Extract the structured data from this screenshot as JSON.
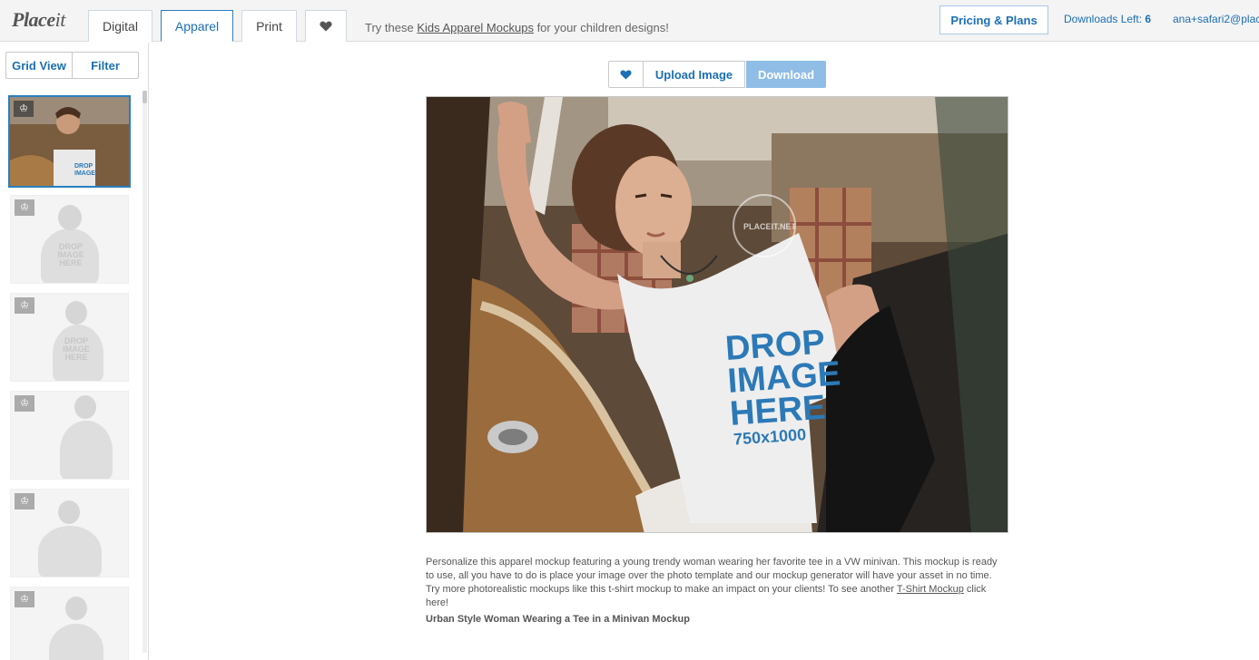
{
  "header": {
    "logo_main": "Place",
    "logo_it": "it",
    "tabs": [
      {
        "label": "Digital"
      },
      {
        "label": "Apparel"
      },
      {
        "label": "Print"
      }
    ],
    "favorites_icon": "heart-icon",
    "promo_prefix": "Try these ",
    "promo_link": "Kids Apparel Mockups",
    "promo_suffix": " for your children designs!",
    "pricing_label": "Pricing & Plans",
    "downloads_label": "Downloads Left: ",
    "downloads_count": "6",
    "user_email": "ana+safari2@plac"
  },
  "sidebar": {
    "grid_view_label": "Grid View",
    "filter_label": "Filter",
    "badge_icon": "crown-icon",
    "shirt_text": "DROP IMAGE HERE"
  },
  "toolbar": {
    "favorite_icon": "heart-icon",
    "upload_label": "Upload Image",
    "download_label": "Download"
  },
  "mockup": {
    "placeholder_line1": "DROP",
    "placeholder_line2": "IMAGE",
    "placeholder_line3": "HERE",
    "placeholder_size": "750x1000",
    "watermark": "PLACEIT.NET"
  },
  "description": {
    "text": "Personalize this apparel mockup featuring a young trendy woman wearing her favorite tee in a VW minivan. This mockup is ready to use, all you have to do is place your image over the photo template and our mockup generator will have your asset in no time. Try more photorealistic mockups like this t-shirt mockup to make an impact on your clients! To see another ",
    "link": "T-Shirt Mockup",
    "suffix": " click here!",
    "caption": "Urban Style Woman Wearing a Tee in a Minivan Mockup"
  },
  "colors": {
    "accent": "#1b6fb5",
    "download_bg": "#8fbde6",
    "selected_border": "#2a7fc0"
  }
}
